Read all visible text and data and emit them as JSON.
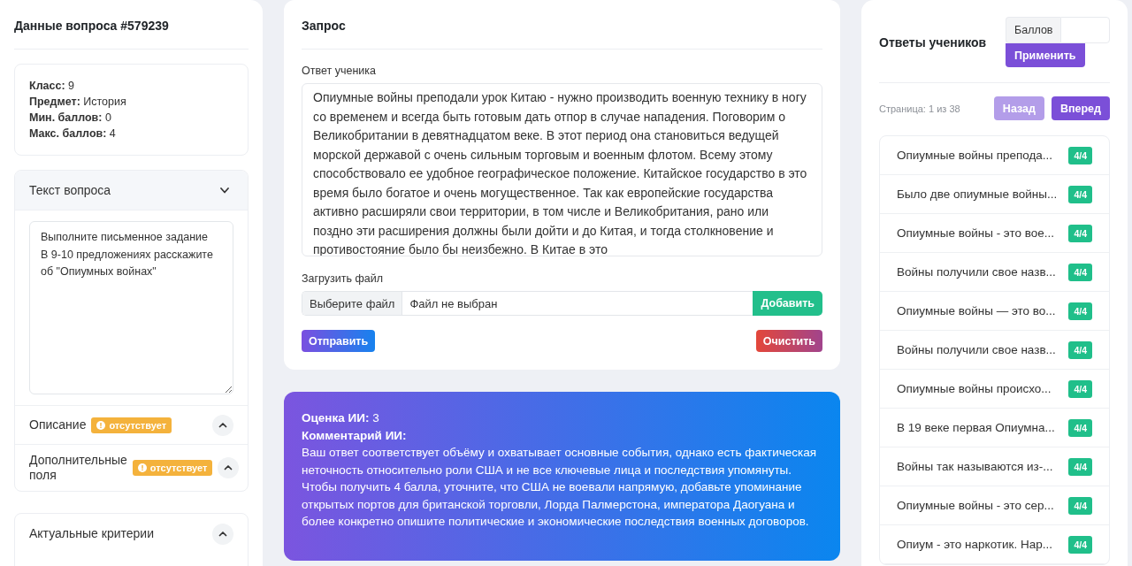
{
  "question_panel": {
    "title": "Данные вопроса #579239",
    "info": [
      "**Класс:** 9",
      "**Предмет:** История",
      "**Мин. баллов:** 0",
      "**Макс. баллов:** 4"
    ],
    "sections": [
      {
        "title": "Текст вопроса",
        "expanded": true,
        "text": "Выполните письменное задание\nВ 9-10 предложениях расскажите об \"Опиумных войнах\""
      },
      {
        "title": "Описание",
        "expanded": false,
        "badge": "отсутствует"
      },
      {
        "title": "Дополнительные поля",
        "expanded": false,
        "badge": "отсутствует"
      }
    ],
    "criteria": {
      "title": "Актуальные критерии",
      "expanded": false
    }
  },
  "request": {
    "title": "Запрос",
    "answer_label": "Ответ ученика",
    "answer": "Опиумные войны преподали урок Китаю - нужно производить военную технику в ногу со временем и всегда быть готовым дать отпор в случае нападения. Поговорим о Великобритании в девятнадцатом веке. В этот период она становиться ведущей морской державой с очень сильным торговым и военным флотом. Всему этому способствовало ее удобное географическое положение. Китайское государство в это время было богатое и очень могущественное. Так как европейские государства активно расширяли свои территории, в том числе и Великобритания, рано или поздно эти расширения должны были дойти и до Китая, и тогда столкновение и противостояние было бы неизбежно. В Китае в это",
    "upload_label": "Загрузить файл",
    "choose_button": "Выберите файл",
    "file_status": "Файл не выбран",
    "add_button": "Добавить",
    "submit_button": "Отправить",
    "clear_button": "Очистить"
  },
  "ai_result": {
    "score": "**Оценка ИИ:** 3",
    "comment_label": "Комментарий ИИ:",
    "comment": "Ваш ответ соответствует объёму и охватывает основные события, однако есть фактическая неточность относительно роли США и не все ключевые лица и последствия упомянуты. Чтобы получить 4 балла, уточните, что США не воевали напрямую, добавьте упоминание открытых портов для британской торговли, Лорда Палмерстона, императора Даогуана и более конкретно опишите политические и экономические последствия военных договоров."
  },
  "answers_panel": {
    "title": "Ответы учеников",
    "score_label": "Баллов",
    "apply_button": "Применить",
    "page_info": "Страница: 1 из 38",
    "pagination": [
      {
        "label": "Назад",
        "disabled": true
      },
      {
        "label": "Вперед",
        "disabled": false
      }
    ],
    "items": [
      {
        "text": "Опиумные войны препода...",
        "score": "4/4"
      },
      {
        "text": "Было две опиумные войны...",
        "score": "4/4"
      },
      {
        "text": "Опиумные войны - это вое...",
        "score": "4/4"
      },
      {
        "text": "Войны получили свое назв...",
        "score": "4/4"
      },
      {
        "text": "Опиумные войны — это во...",
        "score": "4/4"
      },
      {
        "text": "Войны получили свое назв...",
        "score": "4/4"
      },
      {
        "text": "Опиумные войны происхо...",
        "score": "4/4"
      },
      {
        "text": "В 19 веке первая Опиумна...",
        "score": "4/4"
      },
      {
        "text": "Войны так называются из-...",
        "score": "4/4"
      },
      {
        "text": "Опиумные войны - это сер...",
        "score": "4/4"
      },
      {
        "text": "Опиум - это наркотик. Нар...",
        "score": "4/4"
      }
    ]
  }
}
